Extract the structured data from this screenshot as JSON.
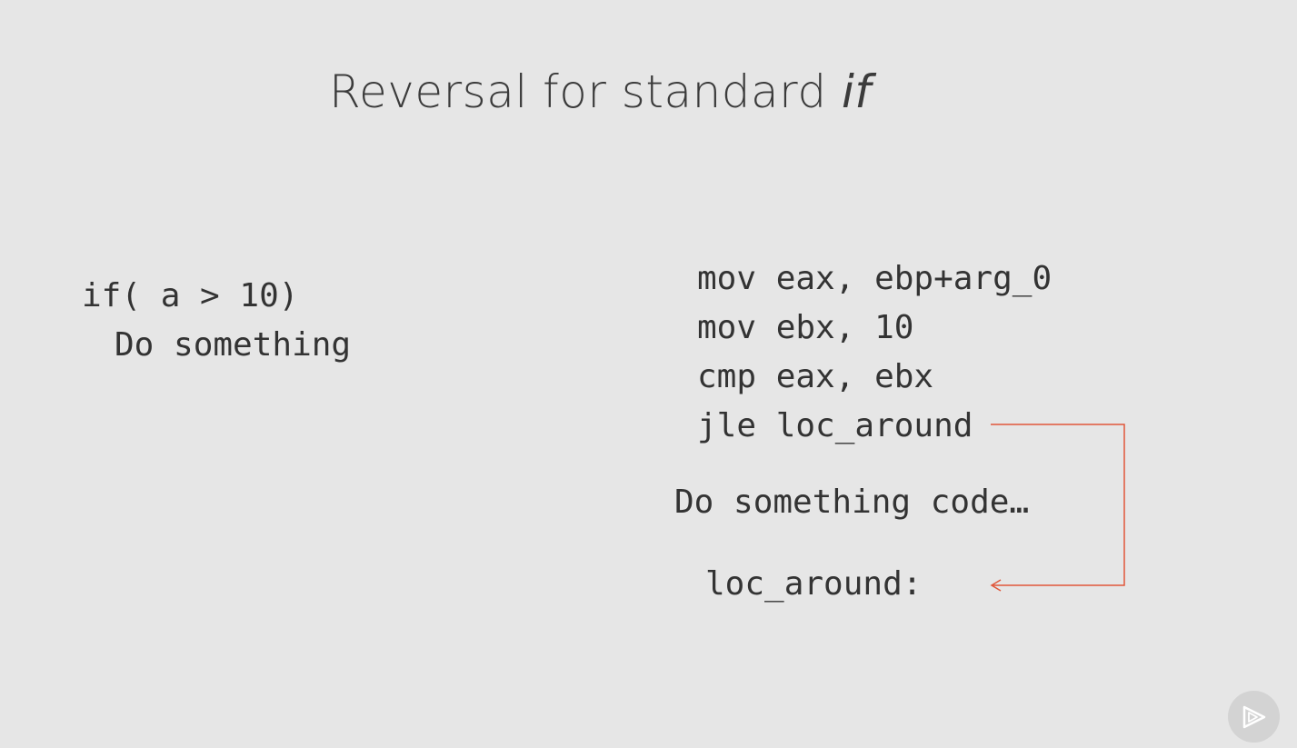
{
  "slide": {
    "title_main": "Reversal for standard ",
    "title_italic": "if"
  },
  "source_code": {
    "line_1": "if( a > 10)",
    "line_2": "Do something"
  },
  "assembly": {
    "line_1": "mov eax, ebp+arg_0",
    "line_2": "mov ebx, 10",
    "line_3": "cmp eax, ebx",
    "line_4": "jle loc_around",
    "body": "Do something code…",
    "label": "loc_around:"
  },
  "colors": {
    "background": "#e6e6e6",
    "text": "#333333",
    "jump_arrow": "#e0573a",
    "logo": "#d3d3d3"
  },
  "icons": {
    "logo": "play-logo-icon",
    "jump": "jump-arrow-icon"
  }
}
